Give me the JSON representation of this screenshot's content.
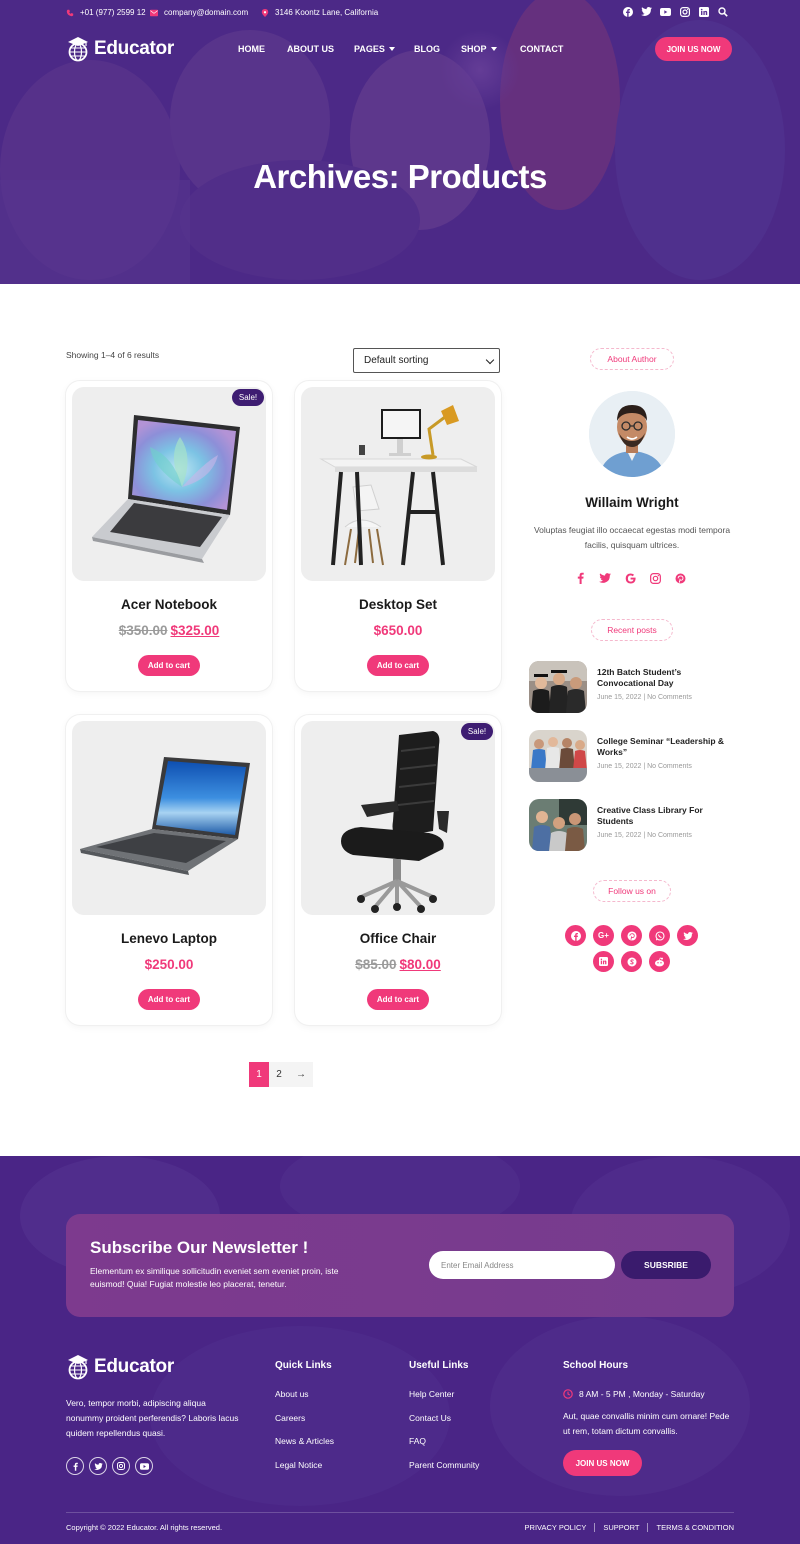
{
  "colors": {
    "primary": "#f0397a",
    "purple": "#4a2586",
    "dark_purple": "#3e1d72"
  },
  "topbar": {
    "phone": "+01 (977) 2599 12",
    "email": "company@domain.com",
    "address": "3146 Koontz Lane, California",
    "social_icons": [
      "facebook-icon",
      "twitter-icon",
      "youtube-icon",
      "instagram-icon",
      "linkedin-icon",
      "search-icon"
    ]
  },
  "nav": {
    "logo": "Educator",
    "items": [
      {
        "label": "HOME",
        "dropdown": false
      },
      {
        "label": "ABOUT US",
        "dropdown": false
      },
      {
        "label": "PAGES",
        "dropdown": true
      },
      {
        "label": "BLOG",
        "dropdown": false
      },
      {
        "label": "SHOP",
        "dropdown": true
      },
      {
        "label": "CONTACT",
        "dropdown": false
      }
    ],
    "cta": "JOIN US NOW"
  },
  "hero": {
    "title": "Archives: Products"
  },
  "shop": {
    "result_count": "Showing 1–4 of 6 results",
    "sort_value": "Default sorting",
    "products": [
      {
        "name": "Acer Notebook",
        "old_price": "$350.00",
        "price": "$325.00",
        "sale": "Sale!",
        "button": "Add to cart"
      },
      {
        "name": "Desktop Set",
        "old_price": "",
        "price": "$650.00",
        "sale": "",
        "button": "Add to cart"
      },
      {
        "name": "Lenevo Laptop",
        "old_price": "",
        "price": "$250.00",
        "sale": "",
        "button": "Add to cart"
      },
      {
        "name": "Office Chair",
        "old_price": "$85.00",
        "price": "$80.00",
        "sale": "Sale!",
        "button": "Add to cart"
      }
    ],
    "pagination": {
      "pages": [
        "1",
        "2"
      ],
      "current": "1",
      "next": "→"
    }
  },
  "sidebar": {
    "about_title": "About Author",
    "author_name": "Willaim Wright",
    "author_bio": "Voluptas feugiat illo occaecat egestas modi tempora facilis, quisquam ultrices.",
    "author_social": [
      "facebook-icon",
      "twitter-icon",
      "google-icon",
      "instagram-icon",
      "pinterest-icon"
    ],
    "recent_title": "Recent posts",
    "posts": [
      {
        "title": "12th Batch Student’s Convocational Day",
        "date": "June 15, 2022",
        "comments": "No Comments"
      },
      {
        "title": "College Seminar “Leadership & Works”",
        "date": "June 15, 2022",
        "comments": "No Comments"
      },
      {
        "title": "Creative Class Library For Students",
        "date": "June 15, 2022",
        "comments": "No Comments"
      }
    ],
    "follow_title": "Follow us on",
    "follow_icons": [
      "facebook-icon",
      "google-plus-icon",
      "pinterest-icon",
      "whatsapp-icon",
      "twitter-icon",
      "linkedin-icon",
      "skype-icon",
      "reddit-icon"
    ]
  },
  "newsletter": {
    "title": "Subscribe Our Newsletter !",
    "text": "Elementum ex similique sollicitudin eveniet sem eveniet proin, iste euismod! Quia! Fugiat molestie leo placerat, tenetur.",
    "placeholder": "Enter Email Address",
    "button": "SUBSRIBE"
  },
  "footer": {
    "logo": "Educator",
    "about": "Vero, tempor morbi, adipiscing aliqua nonummy proident perferendis? Laboris lacus quidem repellendus quasi.",
    "social": [
      "facebook-icon",
      "twitter-icon",
      "instagram-icon",
      "youtube-icon"
    ],
    "quick_links_title": "Quick Links",
    "quick_links": [
      "About us",
      "Careers",
      "News & Articles",
      "Legal Notice"
    ],
    "useful_links_title": "Useful Links",
    "useful_links": [
      "Help Center",
      "Contact Us",
      "FAQ",
      "Parent Community"
    ],
    "hours_title": "School Hours",
    "hours": "8 AM - 5 PM , Monday - Saturday",
    "hours_text": "Aut, quae convallis minim cum ornare! Pede ut rem, totam dictum convallis.",
    "cta": "JOIN US NOW",
    "copyright": "Copyright © 2022 Educator. All rights reserved.",
    "legal": [
      "PRIVACY POLICY",
      "SUPPORT",
      "TERMS & CONDITION"
    ]
  }
}
